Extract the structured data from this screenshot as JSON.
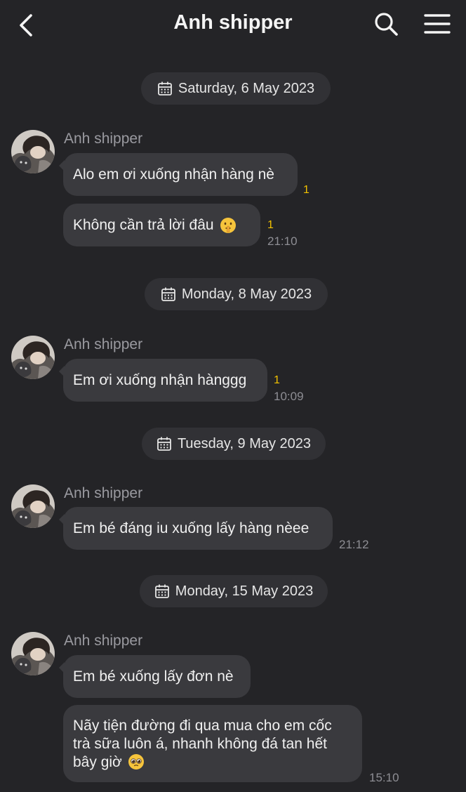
{
  "header": {
    "title": "Anh shipper"
  },
  "colors": {
    "background": "#242427",
    "bubble": "#3a3a3e",
    "date_chip": "#313135",
    "unread_badge": "#f2c200"
  },
  "icons": {
    "back": "chevron-left-icon",
    "search": "search-icon",
    "menu": "hamburger-menu-icon",
    "date": "calendar-icon"
  },
  "conversation": {
    "day1": {
      "date": "Saturday, 6 May 2023",
      "sender": "Anh shipper",
      "messages": [
        {
          "text": "Alo em ơi xuống nhận hàng nè",
          "unread": "1"
        },
        {
          "text": "Không cần trả lời đâu",
          "emoji": "face-with-finger-covering-closed-lips-emoji",
          "unread": "1",
          "time": "21:10"
        }
      ]
    },
    "day2": {
      "date": "Monday, 8 May 2023",
      "sender": "Anh shipper",
      "messages": [
        {
          "text": "Em ơi xuống nhận hànggg",
          "unread": "1",
          "time": "10:09"
        }
      ]
    },
    "day3": {
      "date": "Tuesday, 9 May 2023",
      "sender": "Anh shipper",
      "messages": [
        {
          "text": "Em bé đáng iu xuống lấy hàng nèee",
          "time": "21:12"
        }
      ]
    },
    "day4": {
      "date": "Monday, 15 May 2023",
      "sender": "Anh shipper",
      "messages": [
        {
          "text": "Em bé xuống lấy đơn nè"
        },
        {
          "lines": [
            "Nãy tiện đường đi qua mua cho em cốc",
            "trà sữa luôn á, nhanh không đá tan hết",
            "bây giờ"
          ],
          "emoji": "pleading-face-emoji",
          "time": "15:10"
        }
      ]
    }
  }
}
